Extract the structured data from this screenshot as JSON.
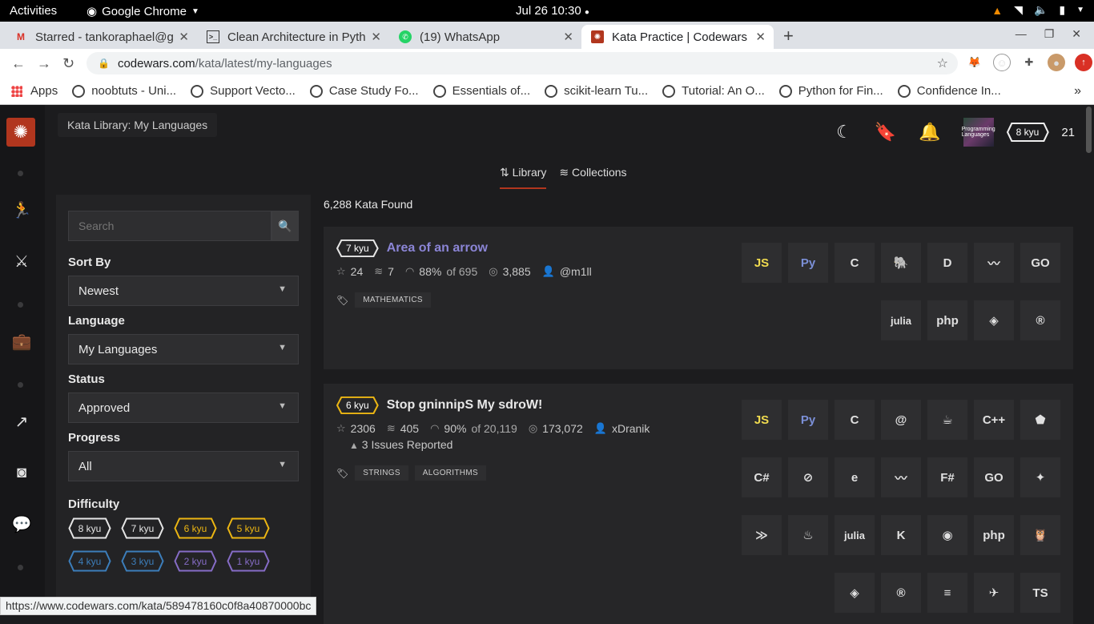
{
  "os": {
    "activities": "Activities",
    "app_menu": "Google Chrome",
    "clock": "Jul 26  10:30"
  },
  "browser": {
    "tabs": [
      {
        "title": "Starred - tankoraphael@g",
        "icon": "gmail-icon"
      },
      {
        "title": "Clean Architecture in Pyth",
        "icon": "terminal-icon"
      },
      {
        "title": "(19) WhatsApp",
        "icon": "whatsapp-icon"
      },
      {
        "title": "Kata Practice | Codewars",
        "icon": "codewars-icon"
      }
    ],
    "url_host": "codewars.com",
    "url_path": "/kata/latest/my-languages",
    "bookmarks": [
      "Apps",
      "noobtuts - Uni...",
      "Support Vecto...",
      "Case Study Fo...",
      "Essentials of...",
      "scikit-learn Tu...",
      "Tutorial: An O...",
      "Python for Fin...",
      "Confidence In..."
    ],
    "status_url": "https://www.codewars.com/kata/589478160c0f8a40870000bc"
  },
  "header": {
    "breadcrumb": "Kata Library: My Languages",
    "rank": "8 kyu",
    "honor": "21",
    "avatar_text": "Programming Languages"
  },
  "tabs": {
    "library": "Library",
    "collections": "Collections"
  },
  "filter": {
    "search_placeholder": "Search",
    "sort_label": "Sort By",
    "sort_value": "Newest",
    "language_label": "Language",
    "language_value": "My Languages",
    "status_label": "Status",
    "status_value": "Approved",
    "progress_label": "Progress",
    "progress_value": "All",
    "difficulty_label": "Difficulty",
    "difficulties": [
      {
        "label": "8 kyu",
        "color": "#e6e6e6"
      },
      {
        "label": "7 kyu",
        "color": "#e6e6e6"
      },
      {
        "label": "6 kyu",
        "color": "#ecb613"
      },
      {
        "label": "5 kyu",
        "color": "#ecb613"
      },
      {
        "label": "4 kyu",
        "color": "#3c7ebb"
      },
      {
        "label": "3 kyu",
        "color": "#3c7ebb"
      },
      {
        "label": "2 kyu",
        "color": "#866cc7"
      },
      {
        "label": "1 kyu",
        "color": "#866cc7"
      }
    ]
  },
  "results": {
    "count_text": "6,288 Kata Found",
    "katas": [
      {
        "rank": "7 kyu",
        "rank_color": "#e6e6e6",
        "title": "Area of an arrow",
        "title_color": "#8b85d6",
        "stars": "24",
        "collections": "7",
        "satisfaction": "88%",
        "of": "of 695",
        "completed": "3,885",
        "author": "@m1ll",
        "issues": "",
        "tags": [
          "MATHEMATICS"
        ],
        "languages": [
          "JS",
          "Py",
          "C",
          "🐘",
          "D",
          "〰",
          "GO",
          "julia",
          "php",
          "◈",
          "®"
        ]
      },
      {
        "rank": "6 kyu",
        "rank_color": "#ecb613",
        "title": "Stop gninnipS My sdroW!",
        "title_color": "#e8e8e8",
        "stars": "2306",
        "collections": "405",
        "satisfaction": "90%",
        "of": "of 20,119",
        "completed": "173,072",
        "author": "xDranik",
        "issues": "3 Issues Reported",
        "tags": [
          "STRINGS",
          "ALGORITHMS"
        ],
        "languages": [
          "JS",
          "Py",
          "C",
          "@",
          "☕",
          "C++",
          "⬟",
          "C#",
          "⊘",
          "e",
          "〰",
          "F#",
          "GO",
          "✦",
          "≫",
          "♨",
          "julia",
          "K",
          "◉",
          "php",
          "🦉",
          "◈",
          "®",
          "≡",
          "✈",
          "TS"
        ]
      }
    ]
  }
}
